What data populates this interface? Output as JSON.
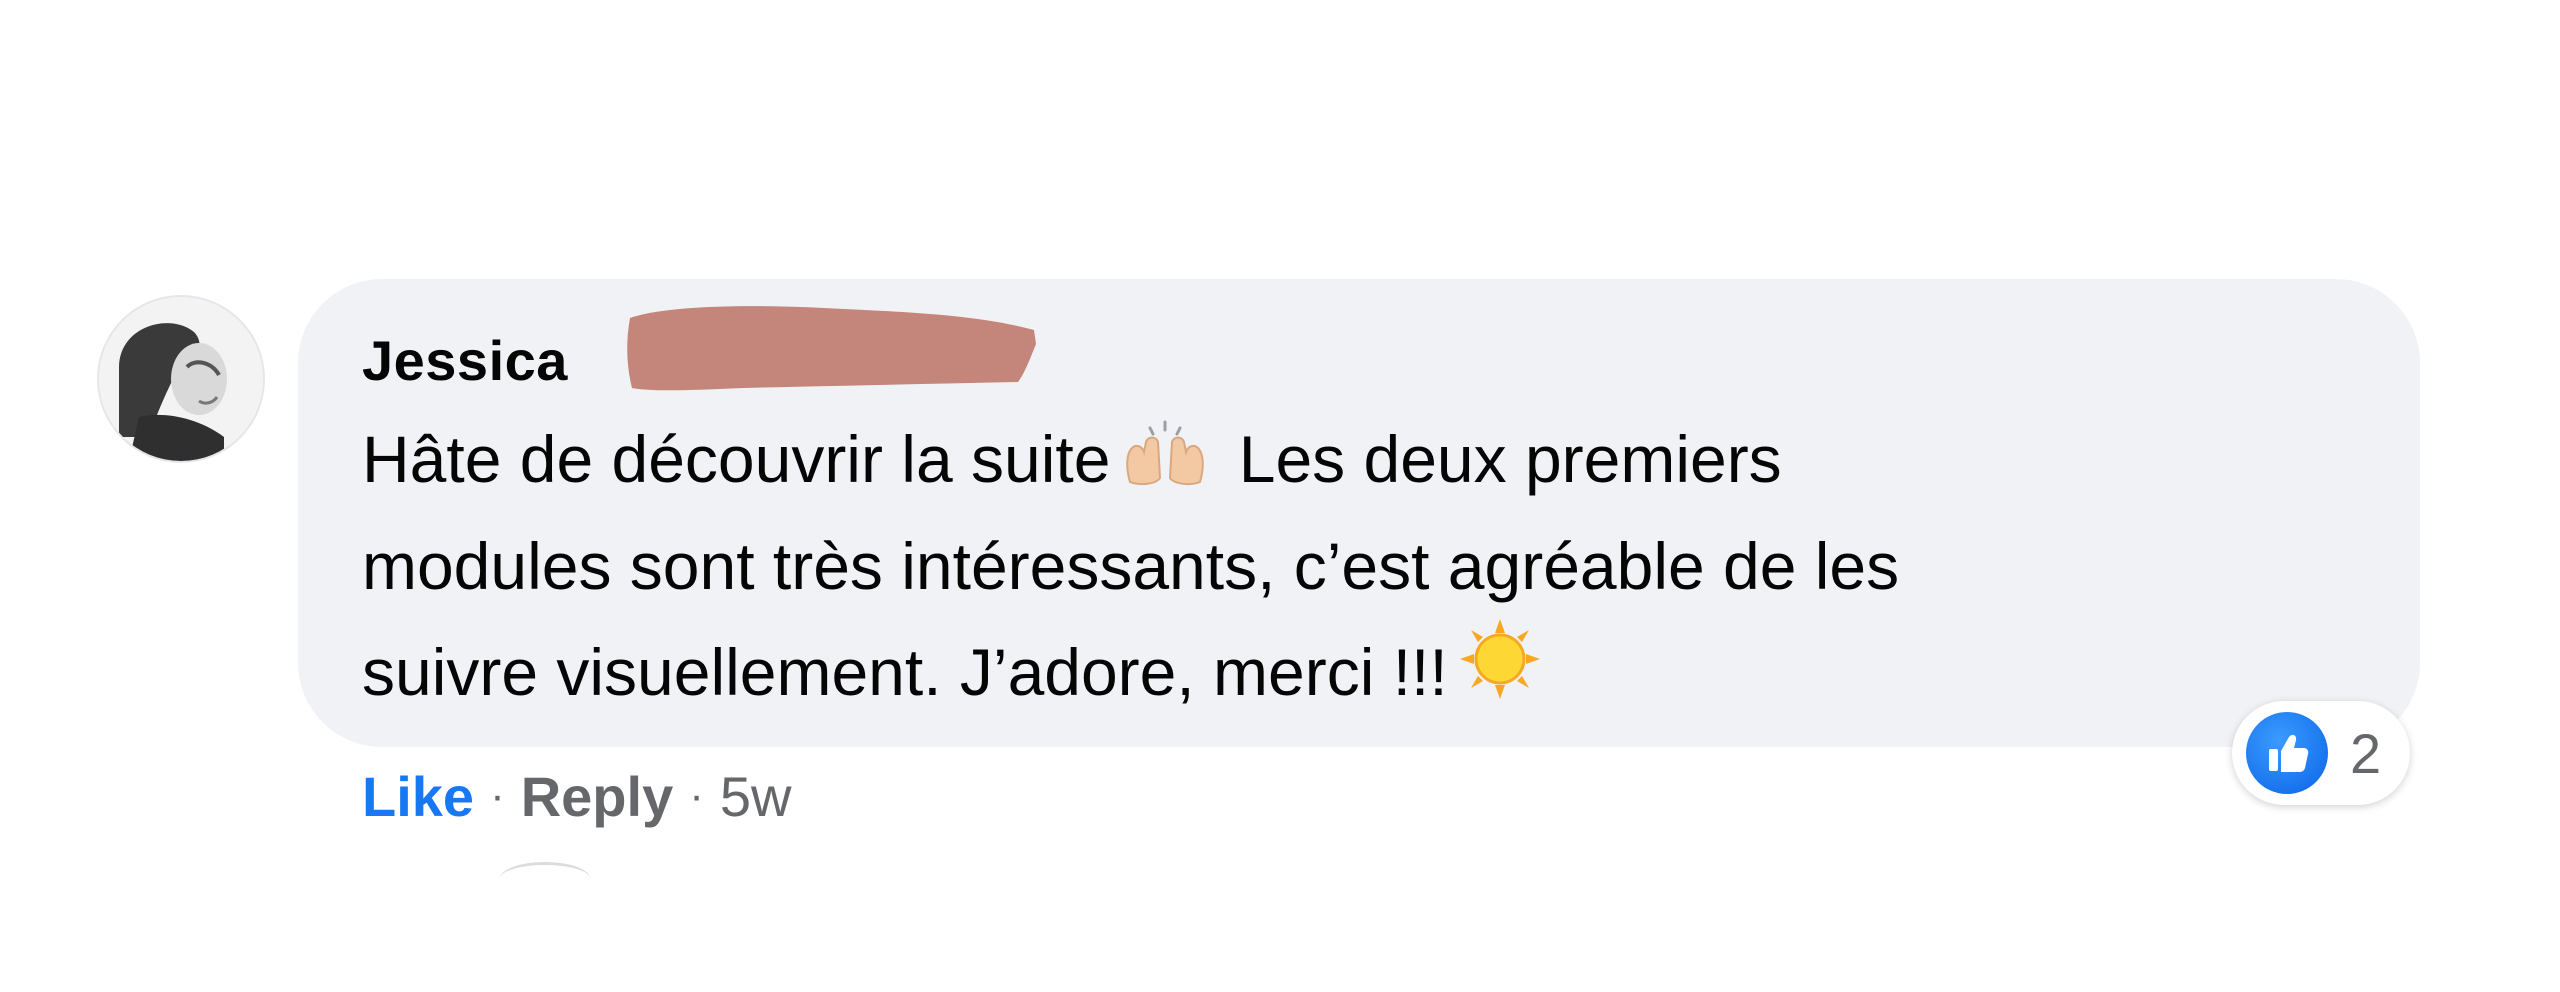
{
  "comment": {
    "author": "Jessica",
    "text_line1": "Hâte de découvrir la suite",
    "text_line1_rest": "Les deux premiers",
    "text_line2": "modules sont très intéressants, c’est agréable de les",
    "text_line3": "suivre visuellement. J’adore, merci !!!",
    "emojis": [
      "raising-hands-emoji",
      "sun-emoji"
    ]
  },
  "actions": {
    "like_label": "Like",
    "reply_label": "Reply",
    "separator": "·",
    "timestamp": "5w"
  },
  "reactions": {
    "type": "like-icon",
    "count": "2"
  },
  "colors": {
    "bubble": "#f0f2f5",
    "like_blue": "#1877f2",
    "muted_text": "#65676b",
    "redaction": "#c4857b"
  }
}
